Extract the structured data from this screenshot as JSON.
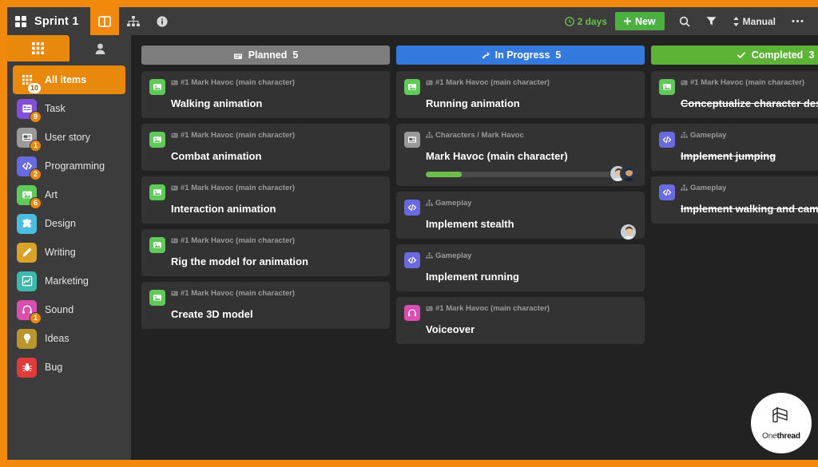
{
  "topbar": {
    "apps_icon": "grid-icon",
    "title": "Sprint 1",
    "views": [
      {
        "name": "board-view",
        "icon": "board-columns-icon",
        "active": true
      },
      {
        "name": "tree-view",
        "icon": "sitemap-icon",
        "active": false
      },
      {
        "name": "info-view",
        "icon": "info-circle-icon",
        "active": false
      }
    ],
    "days_left": "2 days",
    "days_icon": "clock-icon",
    "new_label": "New",
    "new_icon": "plus-icon",
    "search_icon": "search-icon",
    "filter_icon": "filter-icon",
    "sort_label": "Manual",
    "sort_icon": "sort-updown-icon",
    "more_icon": "ellipsis-icon",
    "accent_green": "#4caf3f",
    "accent_orange": "#f2890d"
  },
  "sidebar": {
    "tabs": [
      {
        "name": "items-tab",
        "icon": "grid-icon",
        "active": true
      },
      {
        "name": "people-tab",
        "icon": "user-icon",
        "active": false
      }
    ],
    "items": [
      {
        "label": "All items",
        "icon": "grid-icon",
        "color": "#e8890c",
        "badge": "10",
        "active": true
      },
      {
        "label": "Task",
        "icon": "task-icon",
        "color": "#8250d8",
        "badge": "9",
        "active": false
      },
      {
        "label": "User story",
        "icon": "story-icon",
        "color": "#9a9a9a",
        "badge": "1",
        "active": false
      },
      {
        "label": "Programming",
        "icon": "code-icon",
        "color": "#6a6ae0",
        "badge": "2",
        "active": false
      },
      {
        "label": "Art",
        "icon": "image-icon",
        "color": "#5fc959",
        "badge": "6",
        "active": false
      },
      {
        "label": "Design",
        "icon": "puzzle-icon",
        "color": "#4cbce0",
        "badge": "",
        "active": false
      },
      {
        "label": "Writing",
        "icon": "pencil-icon",
        "color": "#d9a32a",
        "badge": "",
        "active": false
      },
      {
        "label": "Marketing",
        "icon": "chart-icon",
        "color": "#3fb8ae",
        "badge": "",
        "active": false
      },
      {
        "label": "Sound",
        "icon": "headset-icon",
        "color": "#d94fb0",
        "badge": "1",
        "active": false
      },
      {
        "label": "Ideas",
        "icon": "bulb-icon",
        "color": "#b8962c",
        "badge": "",
        "active": false
      },
      {
        "label": "Bug",
        "icon": "bug-icon",
        "color": "#e03b3b",
        "badge": "",
        "active": false
      }
    ]
  },
  "board": {
    "columns": [
      {
        "title": "Planned",
        "count": "5",
        "icon": "calendar-icon",
        "color": "#7d7d7d",
        "cards": [
          {
            "crumb": "#1 Mark Havoc (main character)",
            "crumb_icon": "story-small-icon",
            "title": "Walking animation",
            "icon": "image-icon",
            "color": "#5fc959",
            "done": false
          },
          {
            "crumb": "#1 Mark Havoc (main character)",
            "crumb_icon": "story-small-icon",
            "title": "Combat animation",
            "icon": "image-icon",
            "color": "#5fc959",
            "done": false
          },
          {
            "crumb": "#1 Mark Havoc (main character)",
            "crumb_icon": "story-small-icon",
            "title": "Interaction animation",
            "icon": "image-icon",
            "color": "#5fc959",
            "done": false
          },
          {
            "crumb": "#1 Mark Havoc (main character)",
            "crumb_icon": "story-small-icon",
            "title": "Rig the model for animation",
            "icon": "image-icon",
            "color": "#5fc959",
            "done": false
          },
          {
            "crumb": "#1 Mark Havoc (main character)",
            "crumb_icon": "story-small-icon",
            "title": "Create 3D model",
            "icon": "image-icon",
            "color": "#5fc959",
            "done": false
          }
        ]
      },
      {
        "title": "In Progress",
        "count": "5",
        "icon": "wrench-icon",
        "color": "#3479dd",
        "cards": [
          {
            "crumb": "#1 Mark Havoc (main character)",
            "crumb_icon": "story-small-icon",
            "title": "Running animation",
            "icon": "image-icon",
            "color": "#5fc959",
            "done": false
          },
          {
            "crumb": "Characters / Mark Havoc",
            "crumb_icon": "sitemap-small-icon",
            "title": "Mark Havoc (main character)",
            "icon": "story-icon",
            "color": "#9a9a9a",
            "done": false,
            "avatars": 2,
            "progress": 17
          },
          {
            "crumb": "Gameplay",
            "crumb_icon": "sitemap-small-icon",
            "title": "Implement stealth",
            "icon": "code-icon",
            "color": "#6a6ae0",
            "done": false,
            "avatars": 1
          },
          {
            "crumb": "Gameplay",
            "crumb_icon": "sitemap-small-icon",
            "title": "Implement running",
            "icon": "code-icon",
            "color": "#6a6ae0",
            "done": false
          },
          {
            "crumb": "#1 Mark Havoc (main character)",
            "crumb_icon": "story-small-icon",
            "title": "Voiceover",
            "icon": "headset-icon",
            "color": "#d94fb0",
            "done": false
          }
        ]
      },
      {
        "title": "Completed",
        "count": "3",
        "icon": "check-icon",
        "color": "#5cb335",
        "cards": [
          {
            "crumb": "#1 Mark Havoc (main character)",
            "crumb_icon": "story-small-icon",
            "title": "Conceptualize character design and behavior",
            "icon": "image-icon",
            "color": "#5fc959",
            "done": true
          },
          {
            "crumb": "Gameplay",
            "crumb_icon": "sitemap-small-icon",
            "title": "Implement jumping",
            "icon": "code-icon",
            "color": "#6a6ae0",
            "done": true
          },
          {
            "crumb": "Gameplay",
            "crumb_icon": "sitemap-small-icon",
            "title": "Implement walking and camera controls",
            "icon": "code-icon",
            "color": "#6a6ae0",
            "done": true
          }
        ]
      }
    ]
  },
  "watermark": {
    "name_light": "One",
    "name_bold": "thread",
    "icon": "onethread-logo-icon"
  }
}
